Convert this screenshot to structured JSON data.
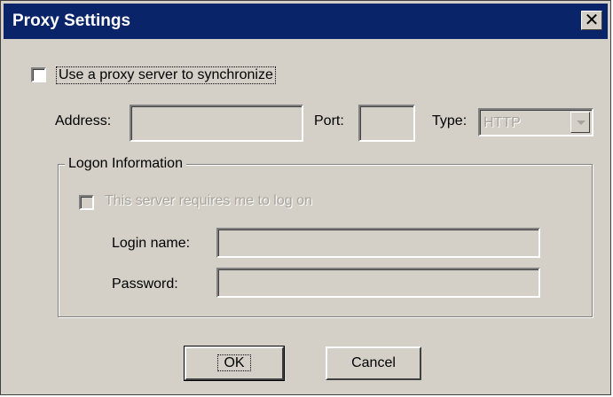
{
  "window": {
    "title": "Proxy Settings",
    "close_label": "✕"
  },
  "proxy": {
    "use_proxy_label": "Use a proxy server to synchronize",
    "use_proxy_checked": false,
    "address_label": "Address:",
    "address_value": "",
    "port_label": "Port:",
    "port_value": "",
    "type_label": "Type:",
    "type_value": "HTTP"
  },
  "logon": {
    "group_title": "Logon Information",
    "requires_logon_label": "This server requires me to log on",
    "requires_logon_checked": false,
    "login_name_label": "Login name:",
    "login_name_value": "",
    "password_label": "Password:",
    "password_value": ""
  },
  "buttons": {
    "ok": "OK",
    "cancel": "Cancel"
  }
}
